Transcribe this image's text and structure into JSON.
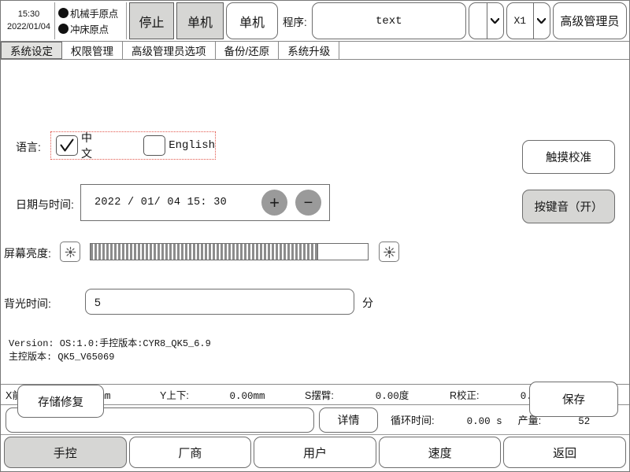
{
  "header": {
    "clock": {
      "time": "15:30",
      "date": "2022/01/04"
    },
    "indicators": [
      {
        "label": "机械手原点",
        "icon": "status-dot-icon",
        "state": "on"
      },
      {
        "label": "冲床原点",
        "icon": "status-dot-icon",
        "state": "on"
      }
    ],
    "stop_button": "停止",
    "mode_button_1": "单机",
    "mode_button_2": "单机",
    "program_label": "程序:",
    "program_value": "text",
    "combo_empty_value": "",
    "combo_axis_value": "X1",
    "admin_button": "高级管理员"
  },
  "tabs": [
    {
      "label": "系统设定",
      "active": true
    },
    {
      "label": "权限管理",
      "active": false
    },
    {
      "label": "高级管理员选项",
      "active": false
    },
    {
      "label": "备份/还原",
      "active": false
    },
    {
      "label": "系统升级",
      "active": false
    }
  ],
  "settings": {
    "language_label": "语言:",
    "language_options": [
      {
        "label": "中文",
        "checked": true
      },
      {
        "label": "English",
        "checked": false
      }
    ],
    "datetime_label": "日期与时间:",
    "datetime_value": "2022 / 01/ 04 15: 30",
    "plus_button": "+",
    "minus_button": "−",
    "brightness_label": "屏幕亮度:",
    "brightness_percent": 82,
    "backlight_label": "背光时间:",
    "backlight_value": "5",
    "backlight_unit": "分",
    "version_line1": "Version: OS:1.0:手控版本:CYR8_QK5_6.9",
    "version_line2": "主控版本: QK5_V65069",
    "touch_calibration_button": "触摸校准",
    "key_sound_button": "按键音（开）",
    "storage_repair_button": "存储修复",
    "save_button": "保存"
  },
  "status": {
    "axes": [
      {
        "name": "X前后:",
        "value": "0.00mm"
      },
      {
        "name": "Y上下:",
        "value": "0.00mm"
      },
      {
        "name": "S摆臂:",
        "value": "0.00度"
      },
      {
        "name": "R校正:",
        "value": "0.00度"
      }
    ],
    "message": "",
    "detail_button": "详情",
    "cycle_time_label": "循环时间:",
    "cycle_time_value": "0.00 s",
    "output_label": "产量:",
    "output_value": "52"
  },
  "bottom_nav": [
    {
      "label": "手控",
      "active": true
    },
    {
      "label": "厂商",
      "active": false
    },
    {
      "label": "用户",
      "active": false
    },
    {
      "label": "速度",
      "active": false
    },
    {
      "label": "返回",
      "active": false
    }
  ],
  "colors": {
    "button_gray": "#d6d6d4",
    "focus_red": "#e2574c",
    "slider_fill": "#8c8c8c"
  }
}
